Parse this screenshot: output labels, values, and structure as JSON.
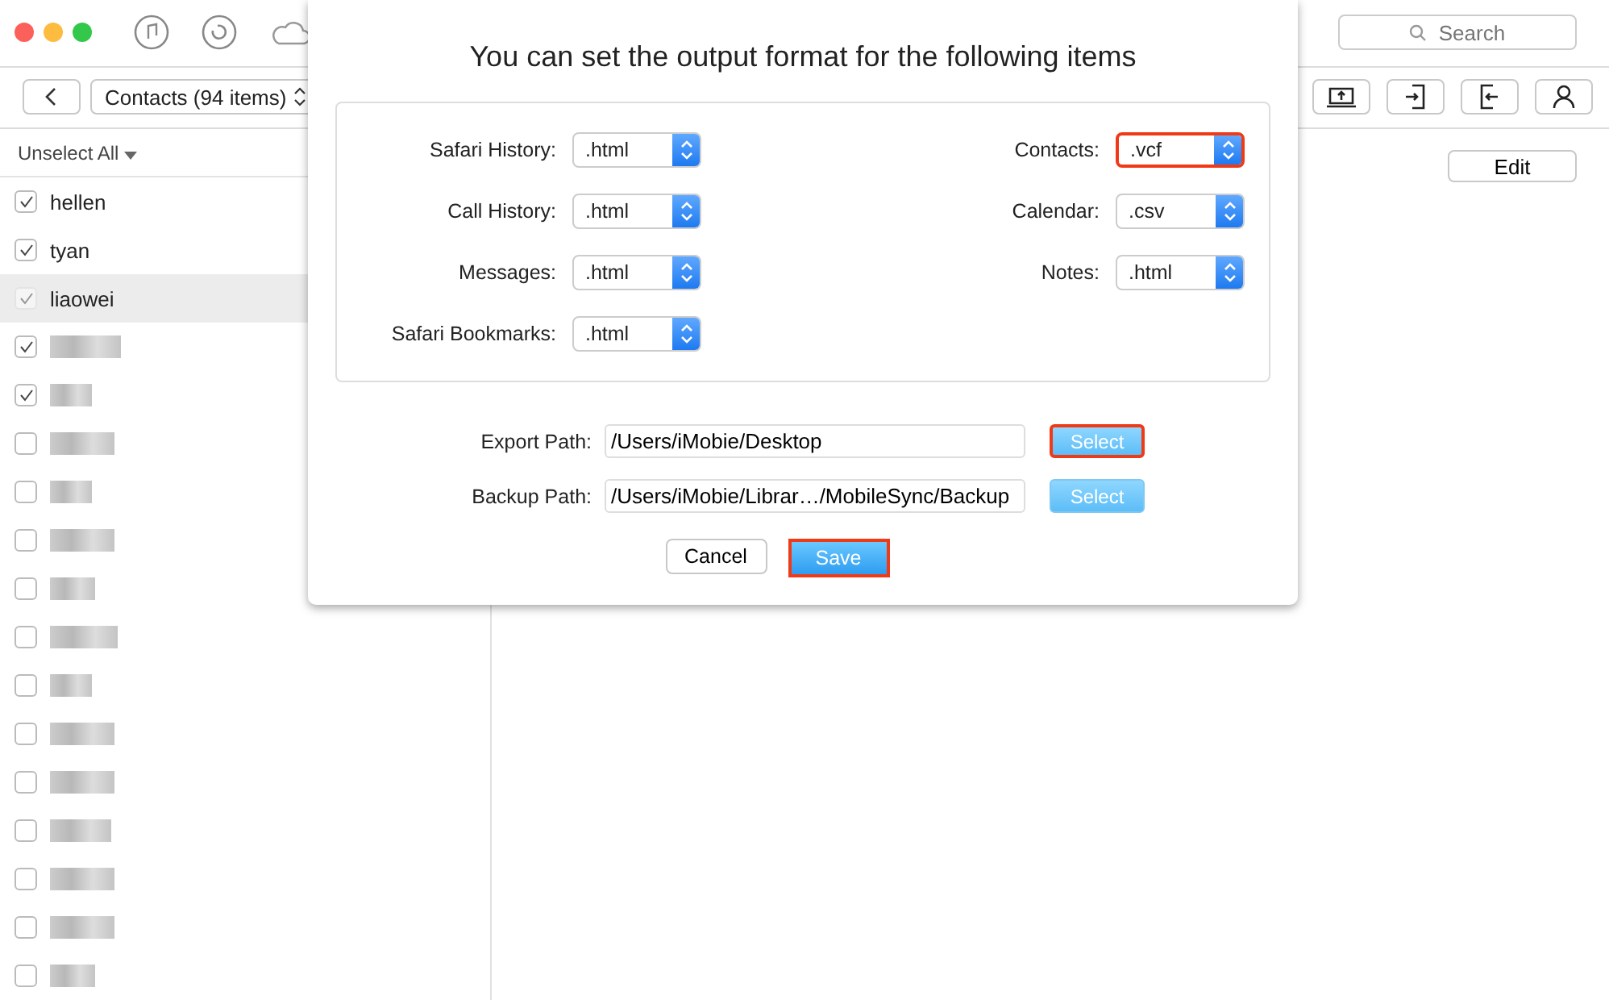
{
  "toolbar": {
    "search": {
      "placeholder": "Search"
    }
  },
  "nav": {
    "category": "Contacts (94 items)"
  },
  "list": {
    "unselect_all": "Unselect All",
    "edit": "Edit",
    "contacts": [
      {
        "kind": "name",
        "name": "hellen",
        "checked": true,
        "selected": false
      },
      {
        "kind": "name",
        "name": "tyan",
        "checked": true,
        "selected": false
      },
      {
        "kind": "name",
        "name": "liaowei",
        "checked": true,
        "selected": true
      },
      {
        "kind": "blurred",
        "checked": true,
        "selected": false
      },
      {
        "kind": "blurred",
        "checked": true,
        "selected": false
      },
      {
        "kind": "blurred",
        "checked": false,
        "selected": false
      },
      {
        "kind": "blurred",
        "checked": false,
        "selected": false
      },
      {
        "kind": "blurred",
        "checked": false,
        "selected": false
      },
      {
        "kind": "blurred",
        "checked": false,
        "selected": false
      },
      {
        "kind": "blurred",
        "checked": false,
        "selected": false
      },
      {
        "kind": "blurred",
        "checked": false,
        "selected": false
      },
      {
        "kind": "blurred",
        "checked": false,
        "selected": false
      },
      {
        "kind": "blurred",
        "checked": false,
        "selected": false
      },
      {
        "kind": "blurred",
        "checked": false,
        "selected": false
      },
      {
        "kind": "blurred",
        "checked": false,
        "selected": false
      },
      {
        "kind": "blurred",
        "checked": false,
        "selected": false
      },
      {
        "kind": "blurred",
        "checked": false,
        "selected": false
      }
    ]
  },
  "dialog": {
    "title": "You can set the output format for the following items",
    "formats_left": [
      {
        "label": "Safari History:",
        "value": ".html",
        "highlighted": false
      },
      {
        "label": "Call History:",
        "value": ".html",
        "highlighted": false
      },
      {
        "label": "Messages:",
        "value": ".html",
        "highlighted": false
      },
      {
        "label": "Safari Bookmarks:",
        "value": ".html",
        "highlighted": false
      }
    ],
    "formats_right": [
      {
        "label": "Contacts:",
        "value": ".vcf",
        "highlighted": true
      },
      {
        "label": "Calendar:",
        "value": ".csv",
        "highlighted": false
      },
      {
        "label": "Notes:",
        "value": ".html",
        "highlighted": false
      }
    ],
    "paths": [
      {
        "label": "Export Path:",
        "value": "/Users/iMobie/Desktop",
        "button": "Select",
        "highlighted": true
      },
      {
        "label": "Backup Path:",
        "value": "/Users/iMobie/Librar…/MobileSync/Backup",
        "button": "Select",
        "highlighted": false
      }
    ],
    "cancel": "Cancel",
    "save": {
      "label": "Save",
      "highlighted": true
    }
  }
}
